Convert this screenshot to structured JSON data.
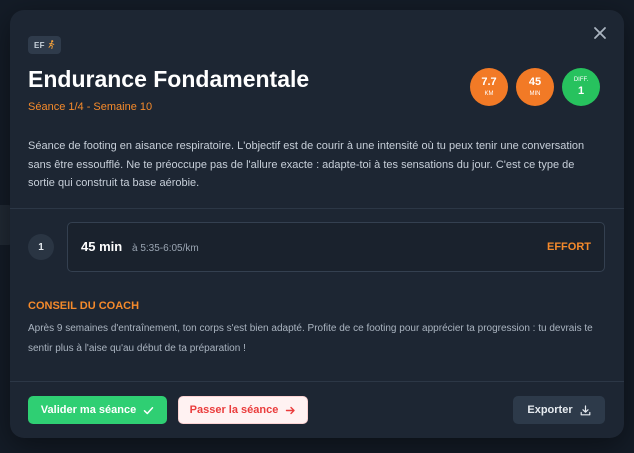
{
  "session": {
    "tag": "EF",
    "tag_icon": "runner-icon",
    "title": "Endurance Fondamentale",
    "subtitle": "Séance 1/4 - Semaine 10",
    "description": "Séance de footing en aisance respiratoire. L'objectif est de courir à une intensité où tu peux tenir une conversation sans être essoufflé. Ne te préoccupe pas de l'allure exacte : adapte-toi à tes sensations du jour. C'est ce type de sortie qui construit ta base aérobie."
  },
  "badges": [
    {
      "value": "7.7",
      "unit": "KM",
      "color": "#f27a26"
    },
    {
      "value": "45",
      "unit": "MIN",
      "color": "#f27a26"
    },
    {
      "value": "1",
      "unit": "DIFF.",
      "color": "#27c25e"
    }
  ],
  "steps": [
    {
      "number": "1",
      "duration": "45 min",
      "pace": "à 5:35-6:05/km",
      "type": "EFFORT"
    }
  ],
  "coach": {
    "title": "CONSEIL DU COACH",
    "text": "Après 9 semaines d'entraînement, ton corps s'est bien adapté. Profite de ce footing pour apprécier ta progression : tu devrais te sentir plus à l'aise qu'au début de ta préparation !"
  },
  "actions": {
    "validate_label": "Valider ma séance",
    "skip_label": "Passer la séance",
    "export_label": "Exporter"
  },
  "colors": {
    "accent": "#f58a2b",
    "success": "#2fcf73",
    "danger": "#ea3c3c"
  }
}
